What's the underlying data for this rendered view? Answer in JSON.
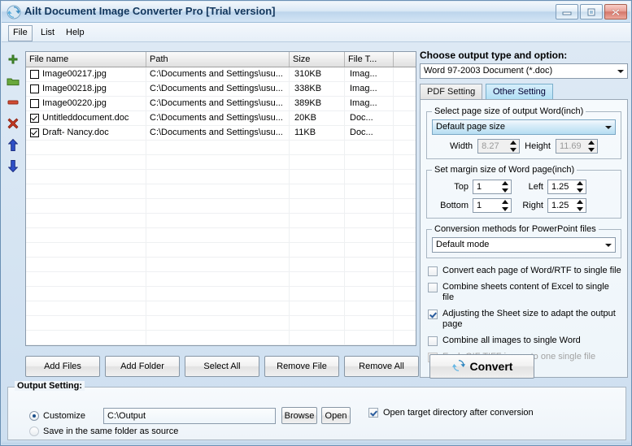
{
  "window": {
    "title": "Ailt Document Image Converter Pro [Trial version]",
    "app_icon": "refresh-circular-arrows-icon",
    "minimize_label": "Minimize",
    "maximize_label": "Maximize",
    "close_label": "Close"
  },
  "menu": {
    "items": [
      {
        "label": "File",
        "active": true
      },
      {
        "label": "List",
        "active": false
      },
      {
        "label": "Help",
        "active": false
      }
    ]
  },
  "rail": {
    "items": [
      {
        "name": "add-file-icon",
        "title": "Add"
      },
      {
        "name": "add-folder-icon",
        "title": "Add Folder"
      },
      {
        "name": "remove-file-icon",
        "title": "Remove"
      },
      {
        "name": "remove-all-icon",
        "title": "Remove All"
      },
      {
        "name": "move-up-icon",
        "title": "Move Up"
      },
      {
        "name": "move-down-icon",
        "title": "Move Down"
      }
    ]
  },
  "filelist": {
    "columns": [
      "File name",
      "Path",
      "Size",
      "File T...",
      ""
    ],
    "rows": [
      {
        "checked": false,
        "name": "Image00217.jpg",
        "path": "C:\\Documents and Settings\\usu...",
        "size": "310KB",
        "type": "Imag..."
      },
      {
        "checked": false,
        "name": "Image00218.jpg",
        "path": "C:\\Documents and Settings\\usu...",
        "size": "338KB",
        "type": "Imag..."
      },
      {
        "checked": false,
        "name": "Image00220.jpg",
        "path": "C:\\Documents and Settings\\usu...",
        "size": "389KB",
        "type": "Imag..."
      },
      {
        "checked": true,
        "name": "Untitleddocument.doc",
        "path": "C:\\Documents and Settings\\usu...",
        "size": "20KB",
        "type": "Doc..."
      },
      {
        "checked": true,
        "name": "Draft- Nancy.doc",
        "path": "C:\\Documents and Settings\\usu...",
        "size": "11KB",
        "type": "Doc..."
      }
    ],
    "empty_row_count": 17
  },
  "output_panel": {
    "title": "Choose output type and option:",
    "output_type": "Word 97-2003 Document (*.doc)",
    "tabs": [
      {
        "label": "PDF Setting",
        "active": false
      },
      {
        "label": "Other Setting",
        "active": true
      }
    ],
    "page_size_group": {
      "legend": "Select page size of output Word(inch)",
      "selected": "Default page size",
      "width_label": "Width",
      "width_value": "8.27",
      "height_label": "Height",
      "height_value": "11.69"
    },
    "margin_group": {
      "legend": "Set margin size of Word page(inch)",
      "top_label": "Top",
      "top_value": "1",
      "left_label": "Left",
      "left_value": "1.25",
      "bottom_label": "Bottom",
      "bottom_value": "1",
      "right_label": "Right",
      "right_value": "1.25"
    },
    "ppt_group": {
      "legend": "Conversion methods for PowerPoint files",
      "selected": "Default mode"
    },
    "checkboxes": [
      {
        "label": "Convert each page of Word/RTF to single file",
        "checked": false,
        "disabled": false
      },
      {
        "label": "Combine sheets content of Excel to single file",
        "checked": false,
        "disabled": false
      },
      {
        "label": "Adjusting the Sheet size to adapt the output page",
        "checked": true,
        "disabled": false
      },
      {
        "label": "Combine all images to single Word",
        "checked": false,
        "disabled": false
      },
      {
        "label": "Each GIF TIFF image to one single file",
        "checked": false,
        "disabled": true
      }
    ]
  },
  "action_buttons": [
    {
      "label": "Add Files"
    },
    {
      "label": "Add Folder"
    },
    {
      "label": "Select All"
    },
    {
      "label": "Remove File"
    },
    {
      "label": "Remove All"
    }
  ],
  "convert": {
    "label": "Convert",
    "icon": "convert-refresh-icon"
  },
  "output_setting": {
    "legend": "Output Setting:",
    "customize_label": "Customize",
    "path_value": "C:\\Output",
    "path_placeholder": "",
    "browse_label": "Browse",
    "open_label": "Open",
    "same_folder_label": "Save in the same folder as source",
    "customize_selected": true,
    "open_target_label": "Open target directory after conversion",
    "open_target_checked": true
  },
  "colors": {
    "accent": "#1b4f8a",
    "tab_active": "#b2e0f5",
    "title_text": "#12365c",
    "close_button": "#d4776b"
  }
}
